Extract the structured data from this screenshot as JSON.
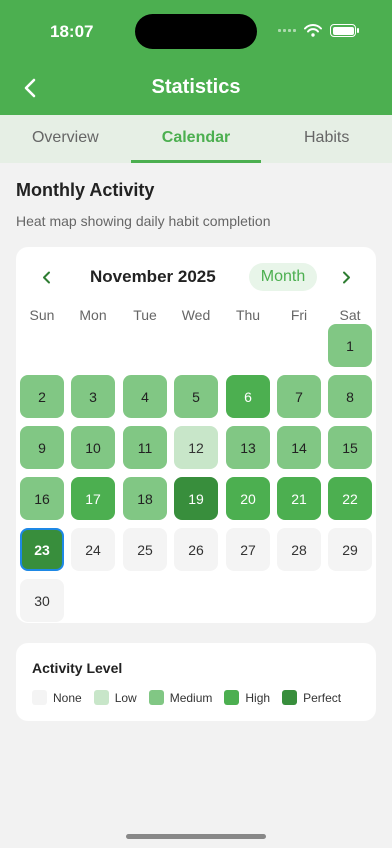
{
  "status_bar": {
    "time": "18:07"
  },
  "header": {
    "title": "Statistics"
  },
  "tabs": [
    {
      "label": "Overview",
      "active": false
    },
    {
      "label": "Calendar",
      "active": true
    },
    {
      "label": "Habits",
      "active": false
    }
  ],
  "section": {
    "title": "Monthly Activity",
    "subtitle": "Heat map showing daily habit completion"
  },
  "calendar": {
    "month_label": "November 2025",
    "view_toggle": "Month",
    "weekdays": [
      "Sun",
      "Mon",
      "Tue",
      "Wed",
      "Thu",
      "Fri",
      "Sat"
    ],
    "first_weekday_index": 6,
    "today": "23",
    "days": [
      {
        "day": "1",
        "level": "medium"
      },
      {
        "day": "2",
        "level": "medium"
      },
      {
        "day": "3",
        "level": "medium"
      },
      {
        "day": "4",
        "level": "medium"
      },
      {
        "day": "5",
        "level": "medium"
      },
      {
        "day": "6",
        "level": "high"
      },
      {
        "day": "7",
        "level": "medium"
      },
      {
        "day": "8",
        "level": "medium"
      },
      {
        "day": "9",
        "level": "medium"
      },
      {
        "day": "10",
        "level": "medium"
      },
      {
        "day": "11",
        "level": "medium"
      },
      {
        "day": "12",
        "level": "low"
      },
      {
        "day": "13",
        "level": "medium"
      },
      {
        "day": "14",
        "level": "medium"
      },
      {
        "day": "15",
        "level": "medium"
      },
      {
        "day": "16",
        "level": "medium"
      },
      {
        "day": "17",
        "level": "high"
      },
      {
        "day": "18",
        "level": "medium"
      },
      {
        "day": "19",
        "level": "perfect"
      },
      {
        "day": "20",
        "level": "high"
      },
      {
        "day": "21",
        "level": "high"
      },
      {
        "day": "22",
        "level": "high"
      },
      {
        "day": "23",
        "level": "perfect"
      },
      {
        "day": "24",
        "level": "none"
      },
      {
        "day": "25",
        "level": "none"
      },
      {
        "day": "26",
        "level": "none"
      },
      {
        "day": "27",
        "level": "none"
      },
      {
        "day": "28",
        "level": "none"
      },
      {
        "day": "29",
        "level": "none"
      },
      {
        "day": "30",
        "level": "none"
      }
    ]
  },
  "legend": {
    "title": "Activity Level",
    "items": [
      {
        "label": "None",
        "level": "none"
      },
      {
        "label": "Low",
        "level": "low"
      },
      {
        "label": "Medium",
        "level": "medium"
      },
      {
        "label": "High",
        "level": "high"
      },
      {
        "label": "Perfect",
        "level": "perfect"
      }
    ]
  },
  "colors": {
    "brand": "#4caf50",
    "none": "#f4f4f4",
    "low": "#c8e6c9",
    "medium": "#81c784",
    "high": "#4caf50",
    "perfect": "#388e3c",
    "today_outline": "#1e88e5"
  }
}
